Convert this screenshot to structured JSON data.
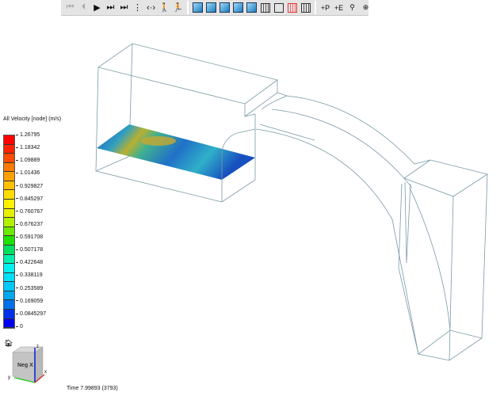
{
  "toolbar": {
    "playback": [
      {
        "icon": "skip-to-start-icon",
        "glyph": "⏮",
        "enabled": false
      },
      {
        "icon": "step-back-icon",
        "glyph": "⏴",
        "enabled": false
      },
      {
        "icon": "play-icon",
        "glyph": "▶",
        "enabled": true
      },
      {
        "icon": "step-forward-icon",
        "glyph": "⏭",
        "enabled": true
      },
      {
        "icon": "skip-to-end-icon",
        "glyph": "⏭",
        "enabled": true
      },
      {
        "icon": "more-vertical-icon",
        "glyph": "⋮",
        "enabled": true
      },
      {
        "icon": "loop-arrows-icon",
        "glyph": "‹·›",
        "enabled": true
      },
      {
        "icon": "walk-icon",
        "glyph": "🚶",
        "enabled": false
      },
      {
        "icon": "run-icon",
        "glyph": "🏃",
        "enabled": false
      }
    ],
    "display": [
      "shaded-cube-icon",
      "smooth-cube-icon",
      "outline-cube-icon",
      "mesh-cube-icon",
      "edges-cube-icon",
      "wireframe-icon",
      "bounding-box-icon",
      "red-wireframe-icon",
      "hidden-line-icon"
    ],
    "probe": [
      {
        "icon": "probe-point-icon",
        "glyph": "+P"
      },
      {
        "icon": "probe-edge-icon",
        "glyph": "+E"
      },
      {
        "icon": "probe-multi-icon",
        "glyph": "⚲"
      },
      {
        "icon": "probe-crosshair-icon",
        "glyph": "⊕"
      }
    ]
  },
  "legend": {
    "title": "All Velocity [node] (m/s)",
    "labels": [
      "1.26795",
      "1.18342",
      "1.09889",
      "1.01436",
      "0.929827",
      "0.845297",
      "0.760767",
      "0.676237",
      "0.591708",
      "0.507178",
      "0.422648",
      "0.338119",
      "0.253589",
      "0.169059",
      "0.0845297",
      "0"
    ],
    "colors": [
      "#ff0000",
      "#ff2200",
      "#ff4a00",
      "#ff7a00",
      "#ffa000",
      "#ffc000",
      "#ffdc00",
      "#fff000",
      "#e8f000",
      "#b4f000",
      "#70e800",
      "#20e000",
      "#00e060",
      "#00f0b0",
      "#00f0f0",
      "#00e0f8",
      "#00c8f8",
      "#00a8f0",
      "#0070e8",
      "#0030e8",
      "#0000f0"
    ]
  },
  "viewcube": {
    "face": "Neg X",
    "axes": {
      "x": "x",
      "y": "y",
      "z": "z"
    }
  },
  "status": {
    "time": "Time 7.99893 (3793)"
  },
  "colors": {
    "wireframe": "#7a9aa6"
  }
}
